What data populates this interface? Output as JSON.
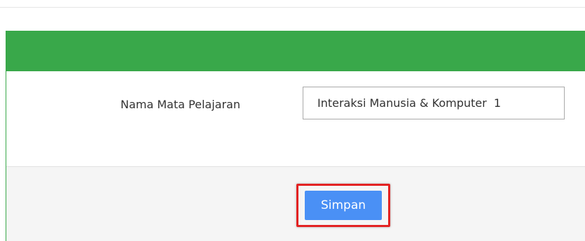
{
  "form": {
    "field_label": "Nama Mata Pelajaran",
    "field_value": "Interaksi Manusia & Komputer  1",
    "save_label": "Simpan"
  },
  "colors": {
    "header": "#39a84a",
    "save_button": "#4a90f5",
    "highlight": "#e32222",
    "footer": "#f5f5f5"
  }
}
